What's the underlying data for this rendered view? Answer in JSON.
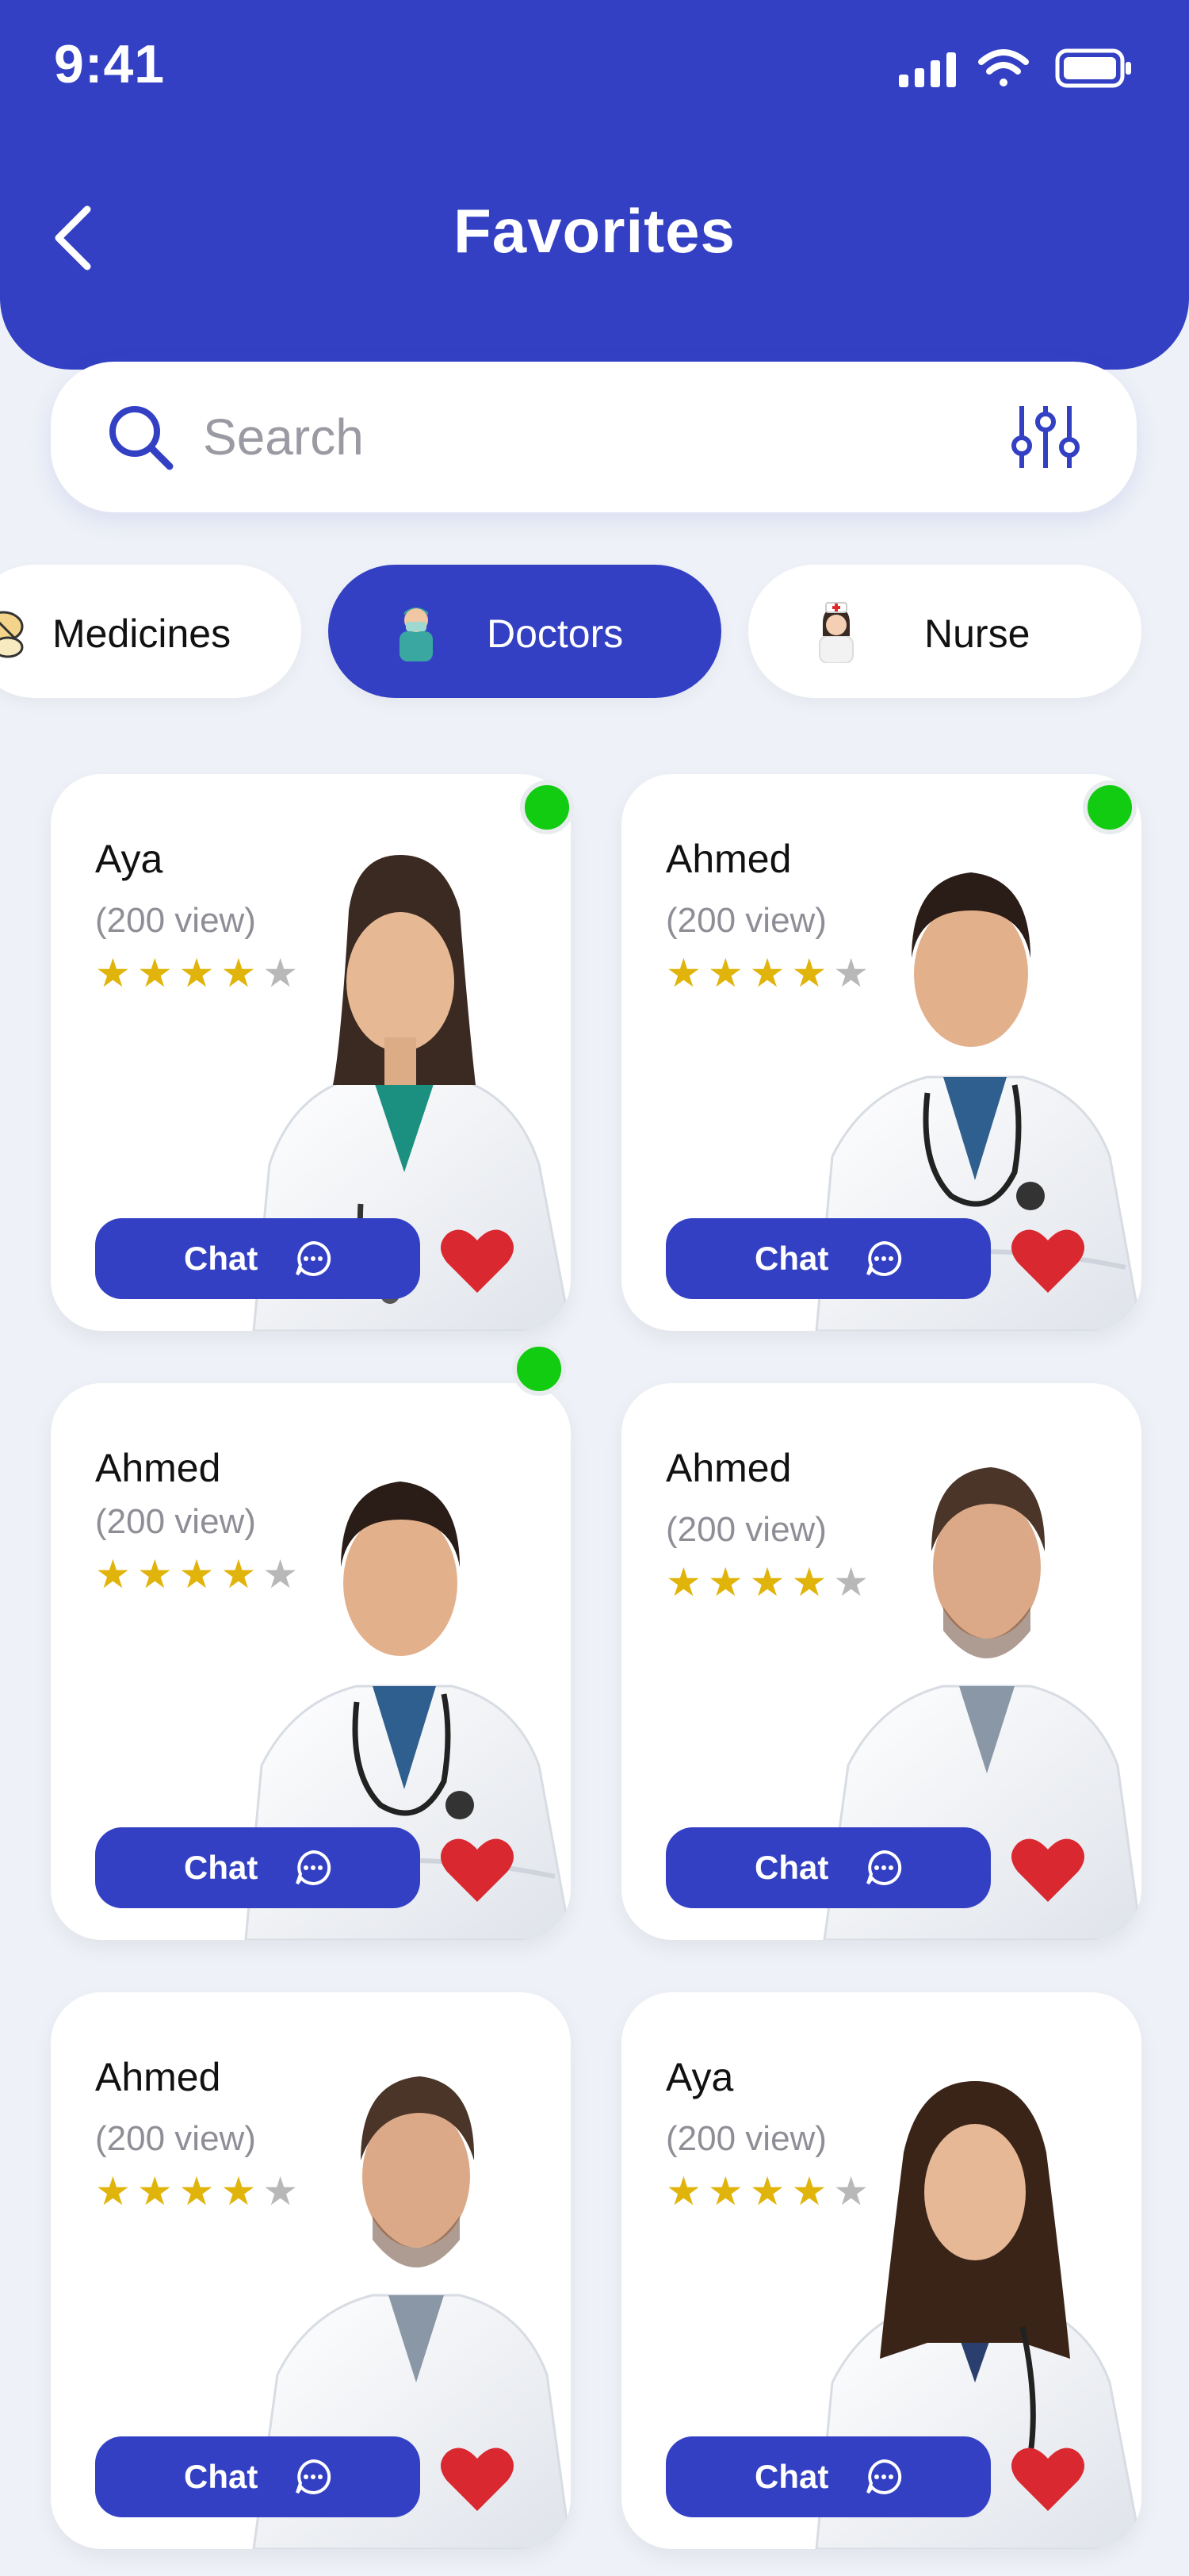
{
  "status": {
    "time": "9:41"
  },
  "header": {
    "title": "Favorites"
  },
  "search": {
    "placeholder": "Search"
  },
  "categories": [
    {
      "label": "Medicines",
      "active": false
    },
    {
      "label": "Doctors",
      "active": true
    },
    {
      "label": "Nurse",
      "active": false
    }
  ],
  "colors": {
    "primary": "#3340c4",
    "star": "#e0b40a",
    "heart": "#d9282f",
    "online": "#12cc12"
  },
  "doctors": [
    {
      "name": "Aya",
      "views": "(200 view)",
      "rating": 4,
      "chat_label": "Chat",
      "online": true
    },
    {
      "name": "Ahmed",
      "views": "(200 view)",
      "rating": 4,
      "chat_label": "Chat",
      "online": true
    },
    {
      "name": "Ahmed",
      "views": "(200 view)",
      "rating": 4,
      "chat_label": "Chat",
      "online": true
    },
    {
      "name": "Ahmed",
      "views": "(200 view)",
      "rating": 4,
      "chat_label": "Chat",
      "online": false
    },
    {
      "name": "Ahmed",
      "views": "(200 view)",
      "rating": 4,
      "chat_label": "Chat",
      "online": false
    },
    {
      "name": "Aya",
      "views": "(200 view)",
      "rating": 4,
      "chat_label": "Chat",
      "online": false
    }
  ]
}
